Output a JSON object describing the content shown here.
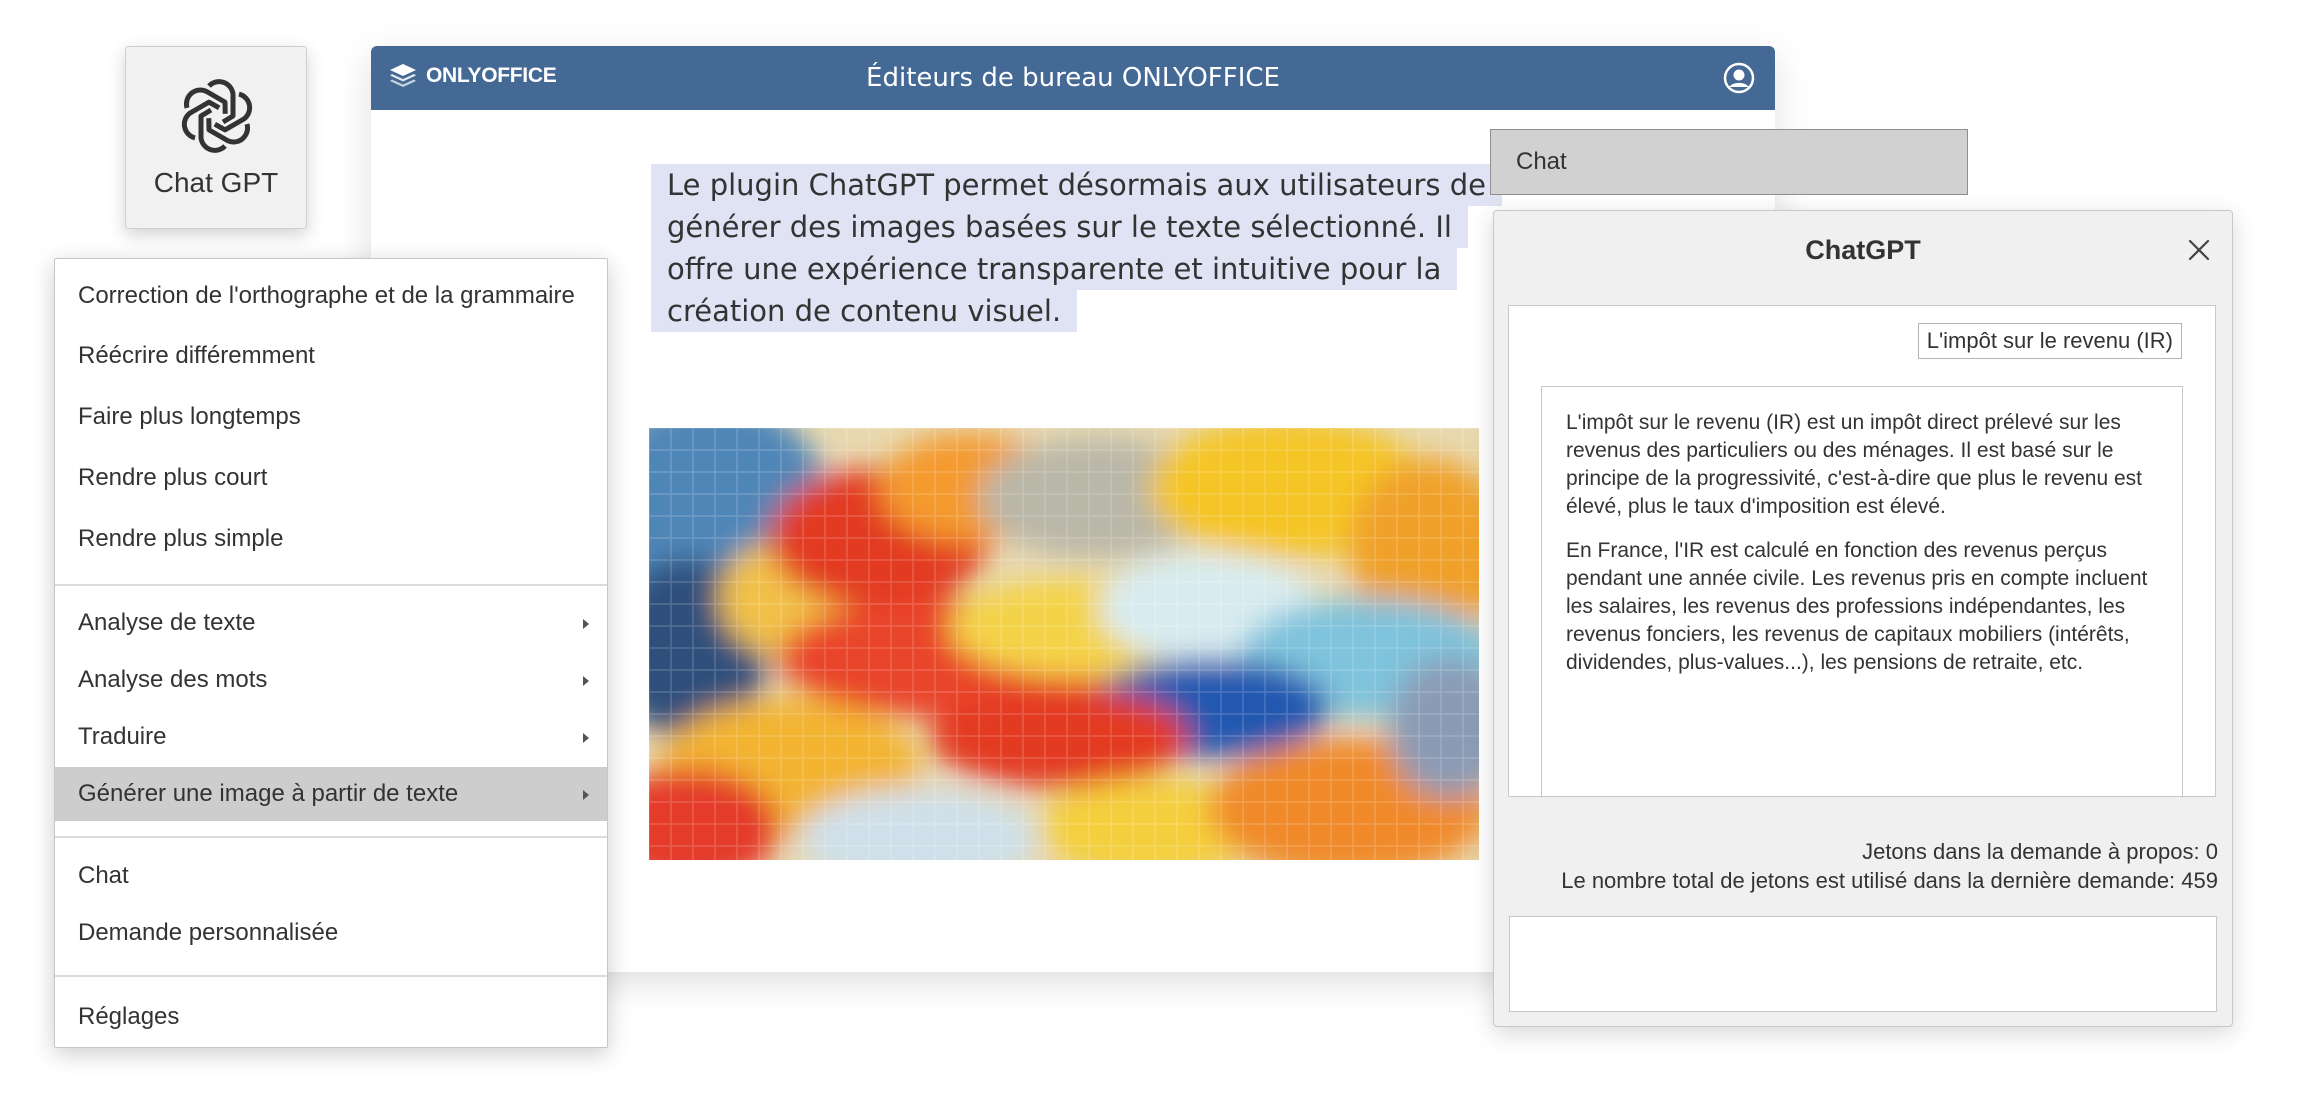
{
  "plugin_button": {
    "label": "Chat GPT",
    "icon": "openai-logo-icon"
  },
  "editor": {
    "logo_text": "ONLYOFFICE",
    "title": "Éditeurs de bureau ONLYOFFICE",
    "selected_lines": [
      "Le plugin ChatGPT permet désormais aux utilisateurs de",
      "générer des images basées sur le texte sélectionné. Il",
      "offre une expérience transparente et intuitive pour la",
      "création de contenu visuel."
    ],
    "image_description_icon": "abstract-painting-image"
  },
  "context_menu": {
    "items": [
      {
        "label": "Correction de l'orthographe et de la grammaire",
        "submenu": false
      },
      {
        "label": "Réécrire différemment",
        "submenu": false
      },
      {
        "label": "Faire plus longtemps",
        "submenu": false
      },
      {
        "label": "Rendre plus court",
        "submenu": false
      },
      {
        "label": "Rendre plus simple",
        "submenu": false
      },
      {
        "label": "Analyse de texte",
        "submenu": true
      },
      {
        "label": "Analyse des mots",
        "submenu": true
      },
      {
        "label": "Traduire",
        "submenu": true
      },
      {
        "label": "Générer une image à partir de texte",
        "submenu": true,
        "active": true
      },
      {
        "label": "Chat",
        "submenu": false
      },
      {
        "label": "Demande personnalisée",
        "submenu": false
      },
      {
        "label": "Réglages",
        "submenu": false
      }
    ]
  },
  "chat_dropdown": {
    "label": "Chat"
  },
  "chatgpt_panel": {
    "title": "ChatGPT",
    "question": "L'impôt sur le revenu (IR)",
    "answer_paragraphs": [
      "L'impôt sur le revenu (IR) est un impôt direct prélevé sur les revenus des particuliers ou des ménages. Il est basé sur le principe de la progressivité, c'est-à-dire que plus le revenu est élevé, plus le taux d'imposition est élevé.",
      "En France, l'IR est calculé en fonction des revenus perçus pendant une année civile. Les revenus pris en compte incluent les salaires, les revenus des professions indépendantes, les revenus fonciers, les revenus de capitaux mobiliers (intérêts, dividendes, plus-values...), les pensions de retraite, etc."
    ],
    "tokens_prompt": "Jetons dans la demande à propos: 0",
    "tokens_total": "Le nombre total de jetons est utilisé dans la dernière demande: 459",
    "input_value": ""
  },
  "colors": {
    "header_blue": "#446995",
    "selection": "#dfe3f4",
    "menu_active": "#cdcdcd"
  }
}
